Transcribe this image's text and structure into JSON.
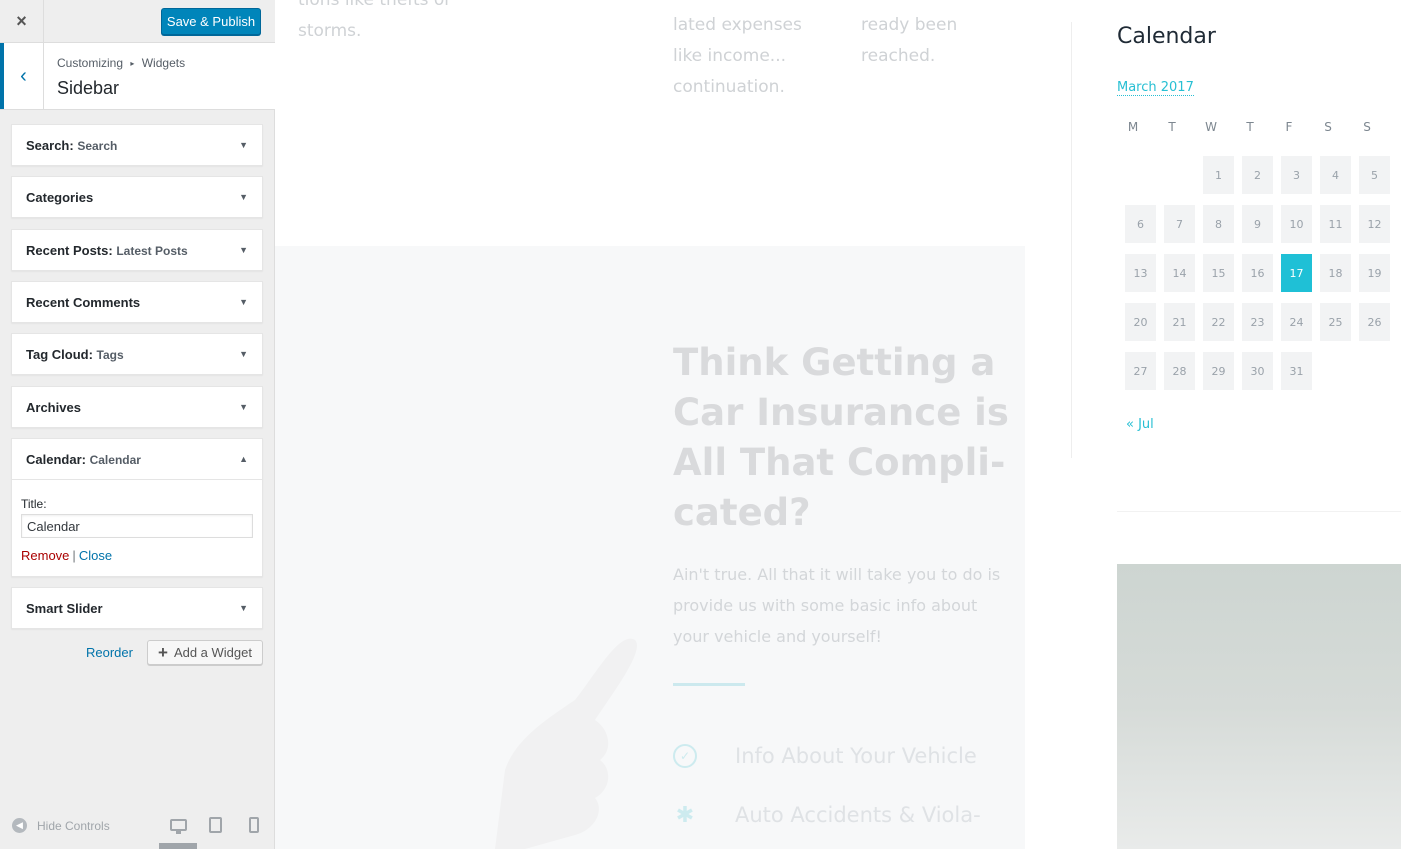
{
  "topbar": {
    "close_symbol": "×",
    "publish_label": "Save & Publish"
  },
  "section": {
    "breadcrumb_root": "Customizing",
    "breadcrumb_sep": "▸",
    "breadcrumb_child": "Widgets",
    "title": "Sidebar"
  },
  "widgets": [
    {
      "name": "Search",
      "title": "Search"
    },
    {
      "name": "Categories",
      "title": ""
    },
    {
      "name": "Recent Posts",
      "title": "Latest Posts"
    },
    {
      "name": "Recent Comments",
      "title": ""
    },
    {
      "name": "Tag Cloud",
      "title": "Tags"
    },
    {
      "name": "Archives",
      "title": ""
    },
    {
      "name": "Calendar",
      "title": "Calendar"
    },
    {
      "name": "Smart Slider",
      "title": ""
    }
  ],
  "calendar_widget_form": {
    "title_label": "Title:",
    "title_value": "Calendar",
    "remove_label": "Remove",
    "separator": "|",
    "close_label": "Close"
  },
  "actions": {
    "reorder_label": "Reorder",
    "add_widget_label": "Add a Widget"
  },
  "footer": {
    "hide_controls_label": "Hide Controls"
  },
  "preview": {
    "snippet_1": "tions like thefts or storms.",
    "snippet_2a": "lated expenses",
    "snippet_2b": "like income...",
    "snippet_2c": "continuation.",
    "snippet_3a": "ready been",
    "snippet_3b": "reached.",
    "hero_title": "Think Getting a Car Insurance is All That Compli-cated?",
    "hero_text": "Ain't true. All that it will take you to do is provide us with some basic info about your vehicle and yourself!",
    "feature_1": "Info About Your Vehicle",
    "feature_2": "Auto Accidents & Viola-"
  },
  "calendar": {
    "heading": "Calendar",
    "caption": "March 2017",
    "weekdays": [
      "M",
      "T",
      "W",
      "T",
      "F",
      "S",
      "S"
    ],
    "first_weekday_index": 2,
    "days_in_month": 31,
    "today": 17,
    "prev_link": "« Jul"
  },
  "colors": {
    "accent": "#1fc0d6",
    "wp_blue": "#0085ba",
    "remove_red": "#aa0000"
  }
}
